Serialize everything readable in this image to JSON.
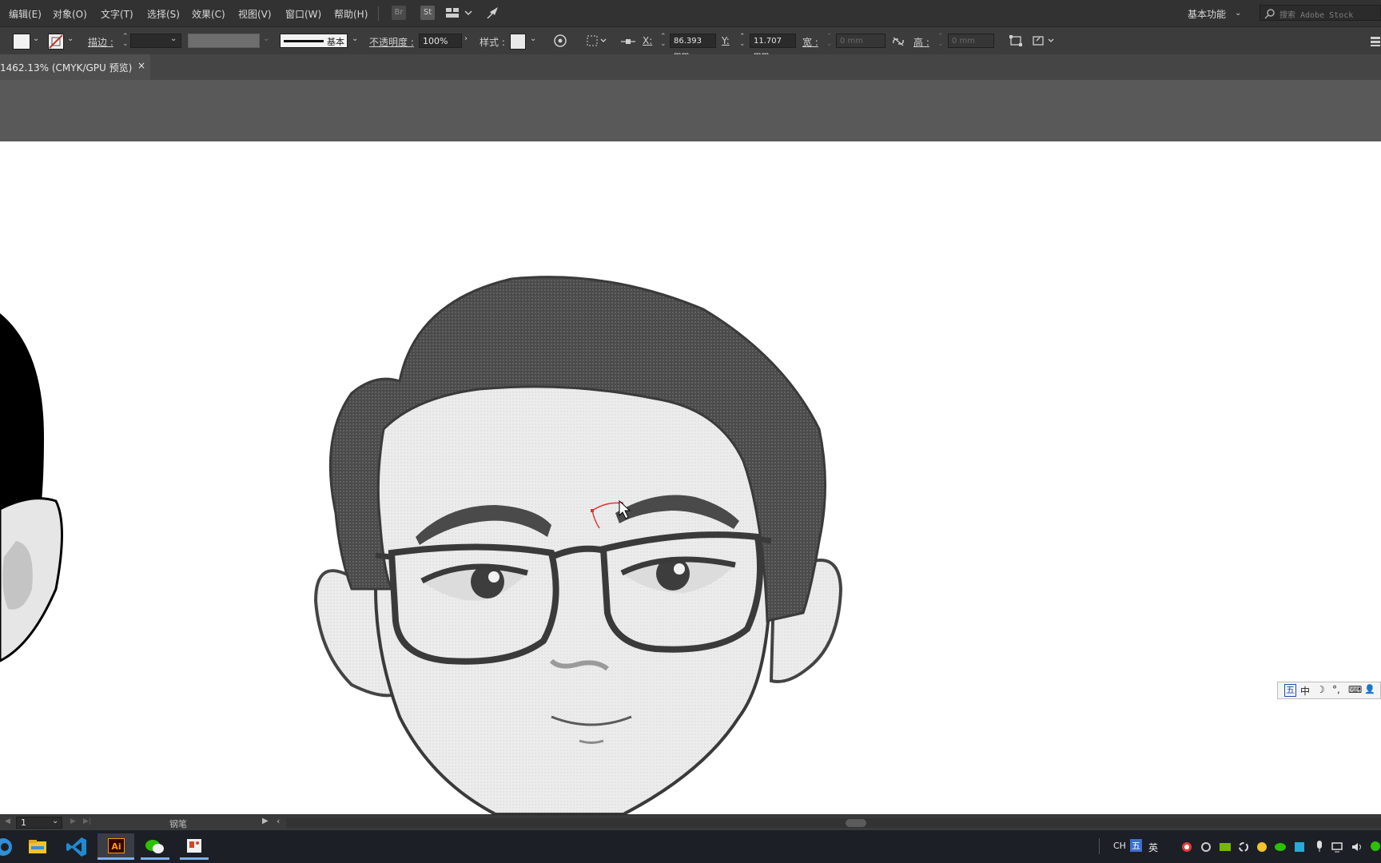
{
  "menu": {
    "items": [
      "编辑(E)",
      "对象(O)",
      "文字(T)",
      "选择(S)",
      "效果(C)",
      "视图(V)",
      "窗口(W)",
      "帮助(H)"
    ],
    "bridge_label": "Br",
    "stock_label": "St",
    "workspace_label": "基本功能",
    "search_placeholder": "搜索 Adobe Stock"
  },
  "control": {
    "stroke_label": "描边 :",
    "stroke_profile": "基本",
    "opacity_label": "不透明度 :",
    "opacity_value": "100%",
    "style_label": "样式 :",
    "x_label": "X:",
    "x_value": "86.393 mm",
    "y_label": "Y:",
    "y_value": "11.707 mm",
    "w_label": "宽 :",
    "w_value": "0 mm",
    "h_label": "高 :",
    "h_value": "0 mm"
  },
  "document": {
    "tab_title": "1462.13% (CMYK/GPU 预览)",
    "close_glyph": "×"
  },
  "status": {
    "artboard_number": "1",
    "current_tool": "钢笔"
  },
  "ime_toolbar": {
    "items": [
      "五",
      "中",
      "☽",
      "°,",
      "⌨",
      "👤"
    ]
  },
  "taskbar": {
    "apps": [
      "edge-icon",
      "file-explorer-icon",
      "vscode-icon",
      "illustrator-icon",
      "wechat-icon",
      "powerpoint-icon"
    ],
    "illustrator_label": "Ai",
    "tray_text": [
      "CH",
      "英"
    ],
    "ime_tray_label": "五"
  },
  "colors": {
    "menubar_bg": "#323232",
    "controlbar_bg": "#3c3c3c",
    "pasteboard_bg": "#595959",
    "canvas_bg": "#ffffff",
    "pen_path": "#d9383a"
  }
}
